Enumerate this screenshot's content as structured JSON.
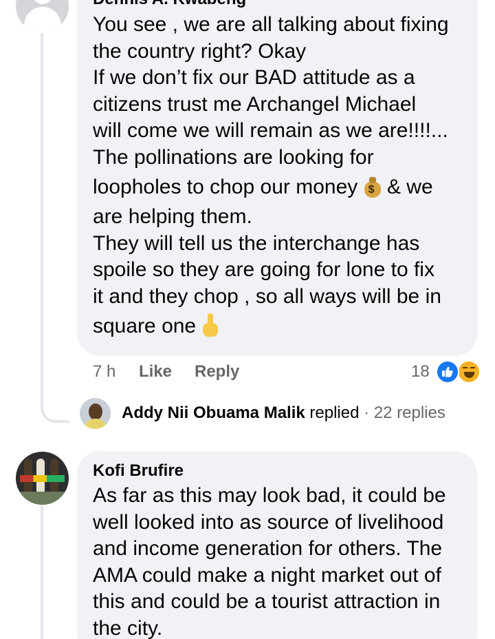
{
  "comment_1": {
    "author": "Dennis A. Kwabeng",
    "lines": [
      "You see , we are all talking about fixing",
      "the country right?  Okay",
      "If we don’t fix our BAD attitude as a",
      "citizens trust me Archangel Michael",
      "will come we will remain as we are!!!!...",
      "The pollinations are looking for",
      "loopholes to chop our money",
      "& we",
      "are helping them.",
      "They  will tell us the interchange has",
      "spoile so they are going for lone to fix",
      "it and they chop , so all ways will be in",
      "square one"
    ],
    "emojis": [
      "money-bag",
      "index-pointing-up"
    ],
    "time": "7 h",
    "like_label": "Like",
    "reply_label": "Reply",
    "reaction_count": "18",
    "reactions": [
      "like",
      "haha"
    ]
  },
  "replies_summary": {
    "name": "Addy Nii Obuama Malik",
    "verb": "replied",
    "separator": "·",
    "count": "22 replies"
  },
  "comment_2": {
    "author": "Kofi Brufire",
    "lines": [
      "As far as this may look bad, it could be",
      "well looked into as source of livelihood",
      "and income generation for others. The",
      "AMA could make a night market out of",
      "this and could be a tourist attraction in",
      "the city."
    ]
  },
  "colors": {
    "bubble": "#f0f2f5",
    "secondary_text": "#65676b",
    "like_blue": "#1877f2",
    "haha_yellow": "#f7b125",
    "thread_line": "#e4e6eb"
  }
}
